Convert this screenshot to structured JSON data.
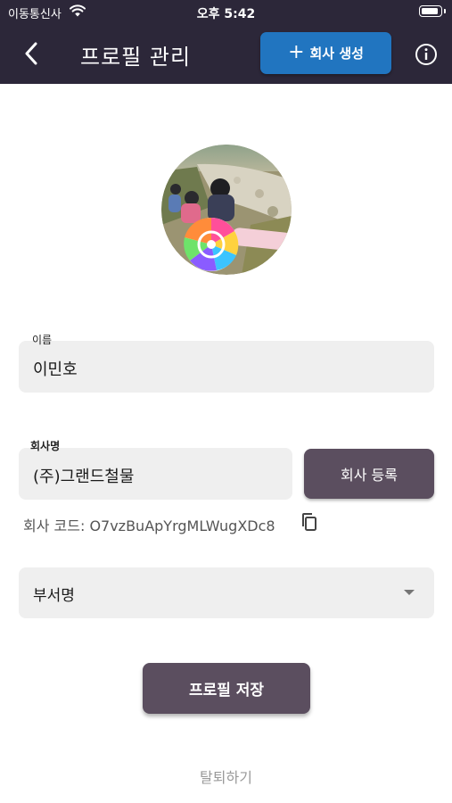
{
  "status_bar": {
    "carrier": "이동통신사",
    "time": "오후 5:42"
  },
  "header": {
    "title": "프로필 관리",
    "create_company_label": "회사 생성",
    "create_company_icon": "+",
    "brand_color": "#2c2739",
    "accent_color": "#2175c0"
  },
  "profile": {
    "avatar_icon": "profile-photo"
  },
  "form": {
    "name_label": "이름",
    "name_value": "이민호",
    "company_label": "회사명",
    "company_value": "(주)그랜드철물",
    "register_label": "회사 등록",
    "company_code_text": "회사 코드: O7vzBuApYrgMLWugXDc8",
    "department_placeholder": "부서명",
    "button_color": "#5b4e5f"
  },
  "actions": {
    "save_label": "프로필 저장",
    "withdraw_label": "탈퇴하기"
  }
}
